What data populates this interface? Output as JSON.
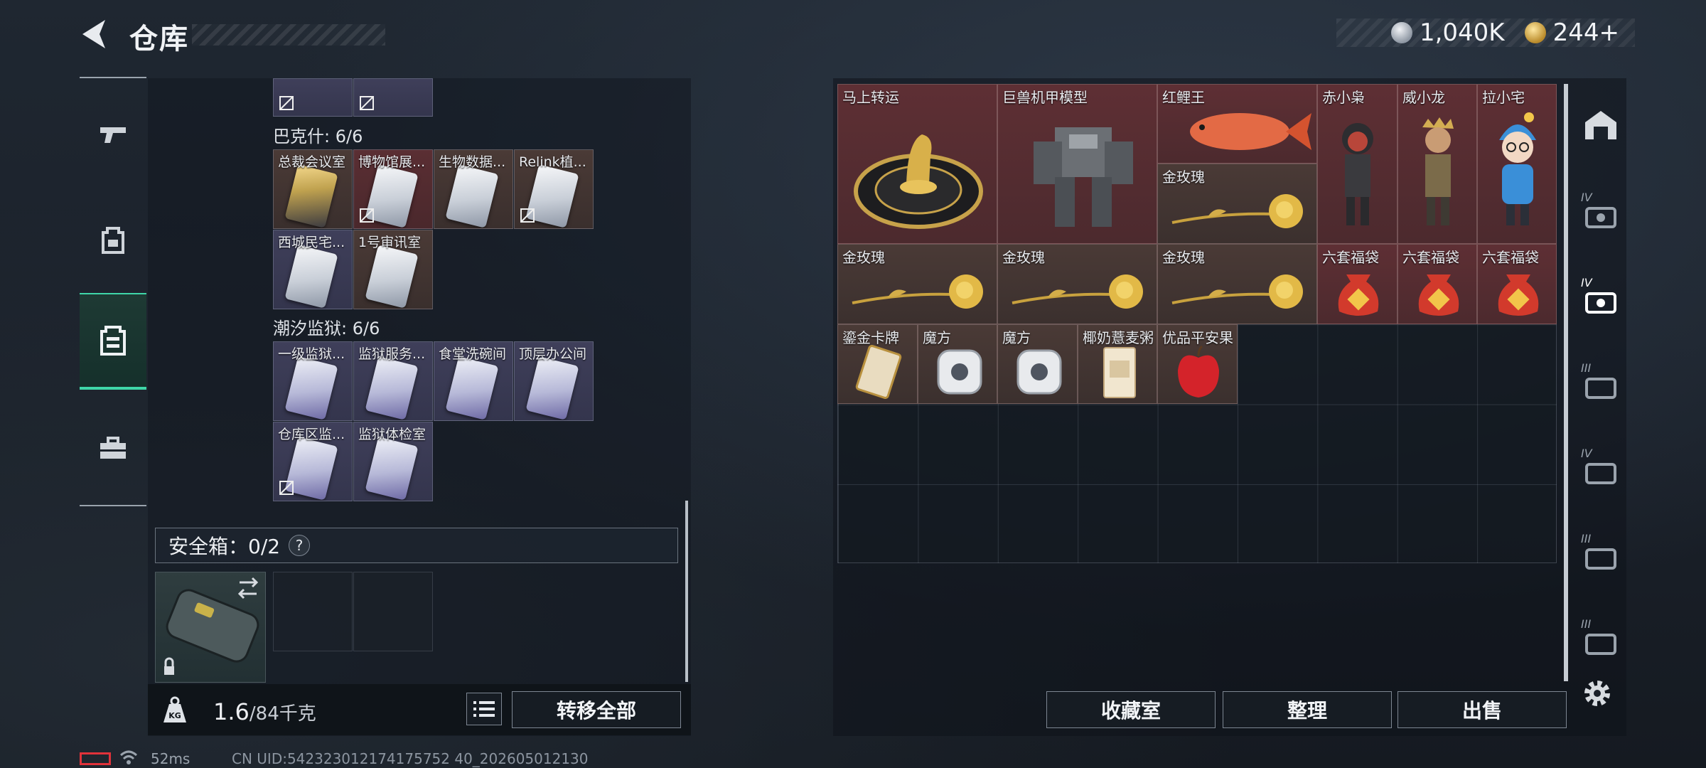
{
  "header": {
    "title": "仓库",
    "currency_silver": "1,040K",
    "currency_gold": "244+"
  },
  "rail": {
    "items": [
      "gun-icon",
      "backpack-icon",
      "vest-icon",
      "toolbox-icon"
    ],
    "active_index": 2
  },
  "left": {
    "group1_label": "巴克什: 6/6",
    "group1_items": [
      "总裁会议室",
      "博物馆展...",
      "生物数据...",
      "Relink植...",
      "西城民宅...",
      "1号审讯室"
    ],
    "group2_label": "潮汐监狱: 6/6",
    "group2_items": [
      "一级监狱...",
      "监狱服务...",
      "食堂洗碗间",
      "顶层办公间",
      "仓库区监...",
      "监狱体检室"
    ],
    "safebox_label": "安全箱：0/2",
    "safebox_help": "?",
    "weight_value": "1.6",
    "weight_unit": "/84千克",
    "weight_icon_text": "KG",
    "transfer_all": "转移全部"
  },
  "stash": {
    "items": [
      "马上转运",
      "巨兽机甲模型",
      "红鲤王",
      "赤小枭",
      "威小龙",
      "拉小宅",
      "金玫瑰",
      "金玫瑰",
      "金玫瑰",
      "金玫瑰",
      "六套福袋",
      "六套福袋",
      "六套福袋",
      "鎏金卡牌",
      "魔方",
      "魔方",
      "椰奶薏麦粥",
      "优品平安果"
    ],
    "tier_labels": [
      "IV",
      "IV",
      "III",
      "IV",
      "III",
      "III"
    ]
  },
  "buttons": {
    "collection": "收藏室",
    "sort": "整理",
    "sell": "出售"
  },
  "status": {
    "ping": "52ms",
    "uid": "CN UID:542323012174175752 40_202605012130"
  },
  "colors": {
    "accent": "#3fd6a8",
    "item_red": "#5e2f34",
    "item_brown": "#4a3a36",
    "item_purple": "#3f3f5a"
  }
}
